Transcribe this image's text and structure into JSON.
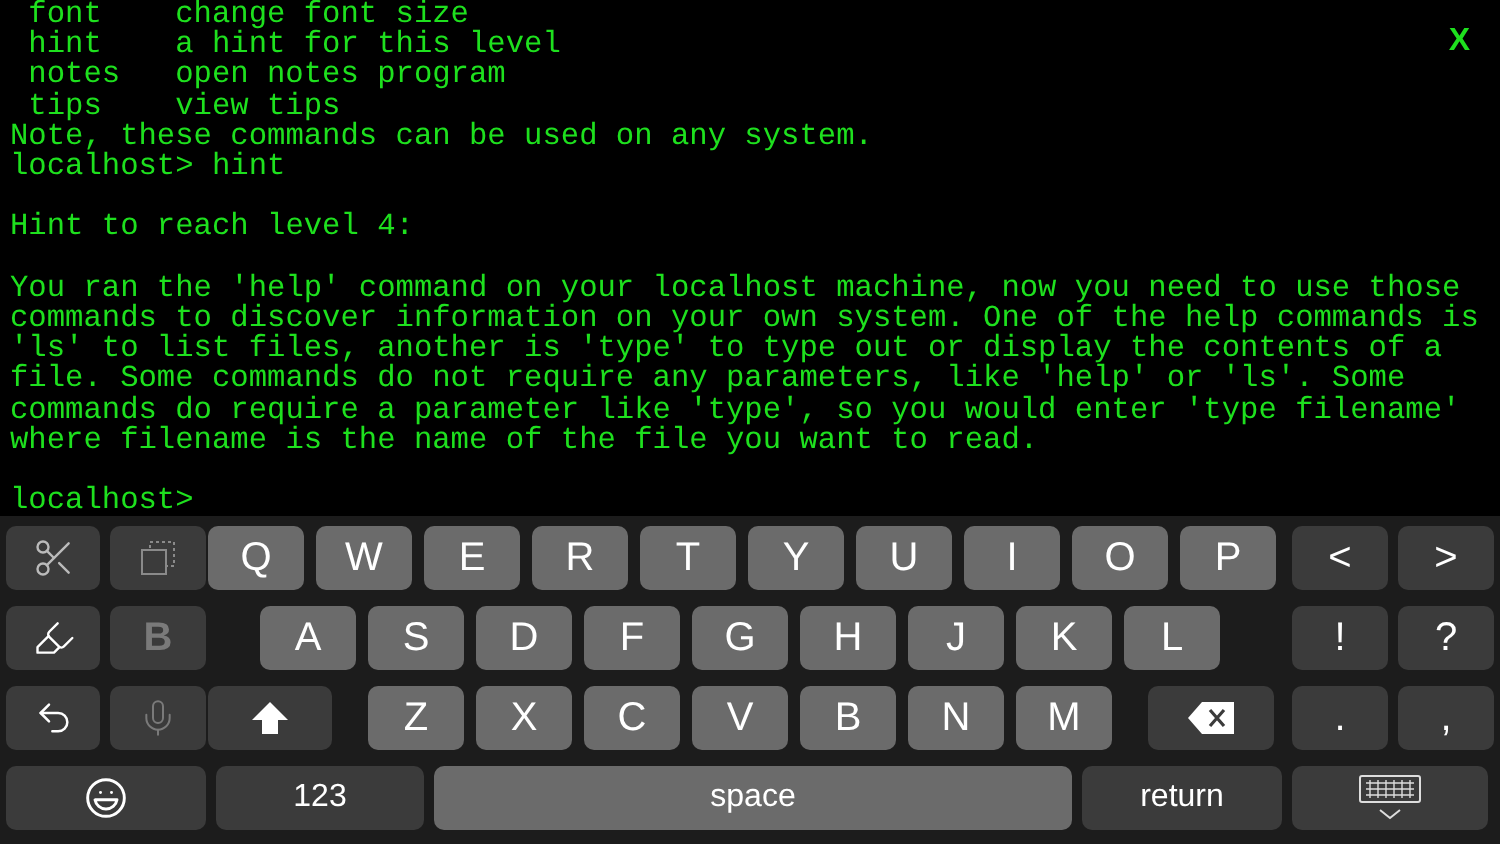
{
  "terminal": {
    "close_label": "X",
    "help_rows": [
      {
        "command": "font",
        "description": "change font size"
      },
      {
        "command": "hint",
        "description": "a hint for this level"
      },
      {
        "command": "notes",
        "description": "open notes program"
      },
      {
        "command": "tips",
        "description": "view tips"
      }
    ],
    "blocks": [
      {
        "lines": [
          "Note, these commands can be used on any system.",
          "localhost> hint"
        ]
      },
      {
        "lines": [
          "Hint to reach level 4:"
        ]
      },
      {
        "lines": [
          "You ran the 'help' command on your localhost machine, now you need to use those",
          "commands to discover information on your own system. One of the help commands is",
          "'ls' to list files, another is 'type' to type out or display the contents of a",
          "file. Some commands do not require any parameters, like 'help' or 'ls'. Some",
          "commands do require a parameter like 'type', so you would enter 'type filename'",
          "where filename is the name of the file you want to read."
        ]
      },
      {
        "lines": [
          "localhost>"
        ]
      }
    ]
  },
  "keyboard": {
    "rows": [
      {
        "keys": [
          {
            "kind": "cut",
            "disabled": false
          },
          {
            "kind": "paste",
            "disabled": true
          },
          {
            "kind": "letter",
            "label": "Q",
            "disabled": false
          },
          {
            "kind": "letter",
            "label": "W",
            "disabled": false
          },
          {
            "kind": "letter",
            "label": "E",
            "disabled": false
          },
          {
            "kind": "letter",
            "label": "R",
            "disabled": false
          },
          {
            "kind": "letter",
            "label": "T",
            "disabled": false
          },
          {
            "kind": "letter",
            "label": "Y",
            "disabled": false
          },
          {
            "kind": "letter",
            "label": "U",
            "disabled": false
          },
          {
            "kind": "letter",
            "label": "I",
            "disabled": false
          },
          {
            "kind": "letter",
            "label": "O",
            "disabled": false
          },
          {
            "kind": "letter",
            "label": "P",
            "disabled": false
          },
          {
            "kind": "key",
            "label": "<",
            "disabled": false
          },
          {
            "kind": "key",
            "label": ">",
            "disabled": false
          }
        ]
      },
      {
        "keys": [
          {
            "kind": "mark",
            "disabled": false
          },
          {
            "kind": "key",
            "label": "B",
            "disabled": true
          },
          {
            "kind": "letter",
            "label": "A",
            "disabled": false
          },
          {
            "kind": "letter",
            "label": "S",
            "disabled": false
          },
          {
            "kind": "letter",
            "label": "D",
            "disabled": false
          },
          {
            "kind": "letter",
            "label": "F",
            "disabled": false
          },
          {
            "kind": "letter",
            "label": "G",
            "disabled": false
          },
          {
            "kind": "letter",
            "label": "H",
            "disabled": false
          },
          {
            "kind": "letter",
            "label": "J",
            "disabled": false
          },
          {
            "kind": "letter",
            "label": "K",
            "disabled": false
          },
          {
            "kind": "letter",
            "label": "L",
            "disabled": false
          },
          {
            "kind": "key",
            "label": "!",
            "disabled": false
          },
          {
            "kind": "key",
            "label": "?",
            "disabled": false
          }
        ]
      },
      {
        "keys": [
          {
            "kind": "undo",
            "disabled": false
          },
          {
            "kind": "dictate",
            "disabled": true
          },
          {
            "kind": "shift",
            "disabled": false
          },
          {
            "kind": "letter",
            "label": "Z",
            "disabled": false
          },
          {
            "kind": "letter",
            "label": "X",
            "disabled": false
          },
          {
            "kind": "letter",
            "label": "C",
            "disabled": false
          },
          {
            "kind": "letter",
            "label": "V",
            "disabled": false
          },
          {
            "kind": "letter",
            "label": "B",
            "disabled": false
          },
          {
            "kind": "letter",
            "label": "N",
            "disabled": false
          },
          {
            "kind": "letter",
            "label": "M",
            "disabled": false
          },
          {
            "kind": "delete",
            "disabled": false
          },
          {
            "kind": "key",
            "label": ".",
            "disabled": false
          },
          {
            "kind": "key",
            "label": ",",
            "disabled": false
          }
        ]
      },
      {
        "keys": [
          {
            "kind": "emoji",
            "disabled": false
          },
          {
            "kind": "key",
            "label": "123",
            "disabled": false
          },
          {
            "kind": "space",
            "label": "space",
            "disabled": false
          },
          {
            "kind": "key",
            "label": "return",
            "disabled": false
          },
          {
            "kind": "dismiss",
            "disabled": false
          }
        ]
      }
    ]
  }
}
